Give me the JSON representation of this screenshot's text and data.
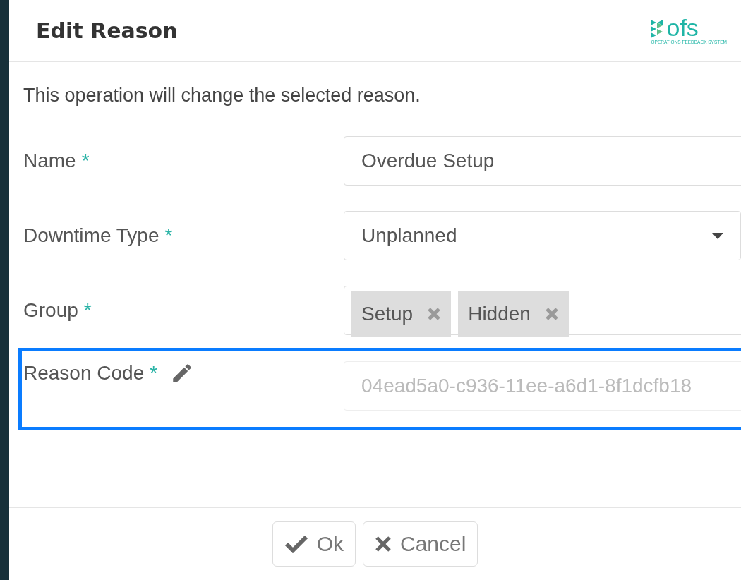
{
  "dialog": {
    "title": "Edit Reason",
    "logo": {
      "text": "ofs",
      "subtitle": "OPERATIONS FEEDBACK SYSTEM"
    },
    "message": "This operation will change the selected reason.",
    "fields": [
      {
        "kind": "text",
        "label": "Name",
        "required": "*",
        "value": "Overdue Setup",
        "disabled": false,
        "highlighted": false,
        "editable_icon": false
      },
      {
        "kind": "select",
        "label": "Downtime Type",
        "required": "*",
        "value": "Unplanned",
        "disabled": false,
        "highlighted": false,
        "editable_icon": false
      },
      {
        "kind": "tags",
        "label": "Group",
        "required": "*",
        "tags": [
          "Setup",
          "Hidden"
        ],
        "disabled": false,
        "highlighted": false,
        "editable_icon": false
      },
      {
        "kind": "text",
        "label": "Reason Code",
        "required": "*",
        "value": "04ead5a0-c936-11ee-a6d1-8f1dcfb18",
        "disabled": true,
        "highlighted": true,
        "editable_icon": true
      }
    ],
    "buttons": [
      {
        "kind": "ok",
        "label": "Ok"
      },
      {
        "kind": "cancel",
        "label": "Cancel"
      }
    ]
  }
}
